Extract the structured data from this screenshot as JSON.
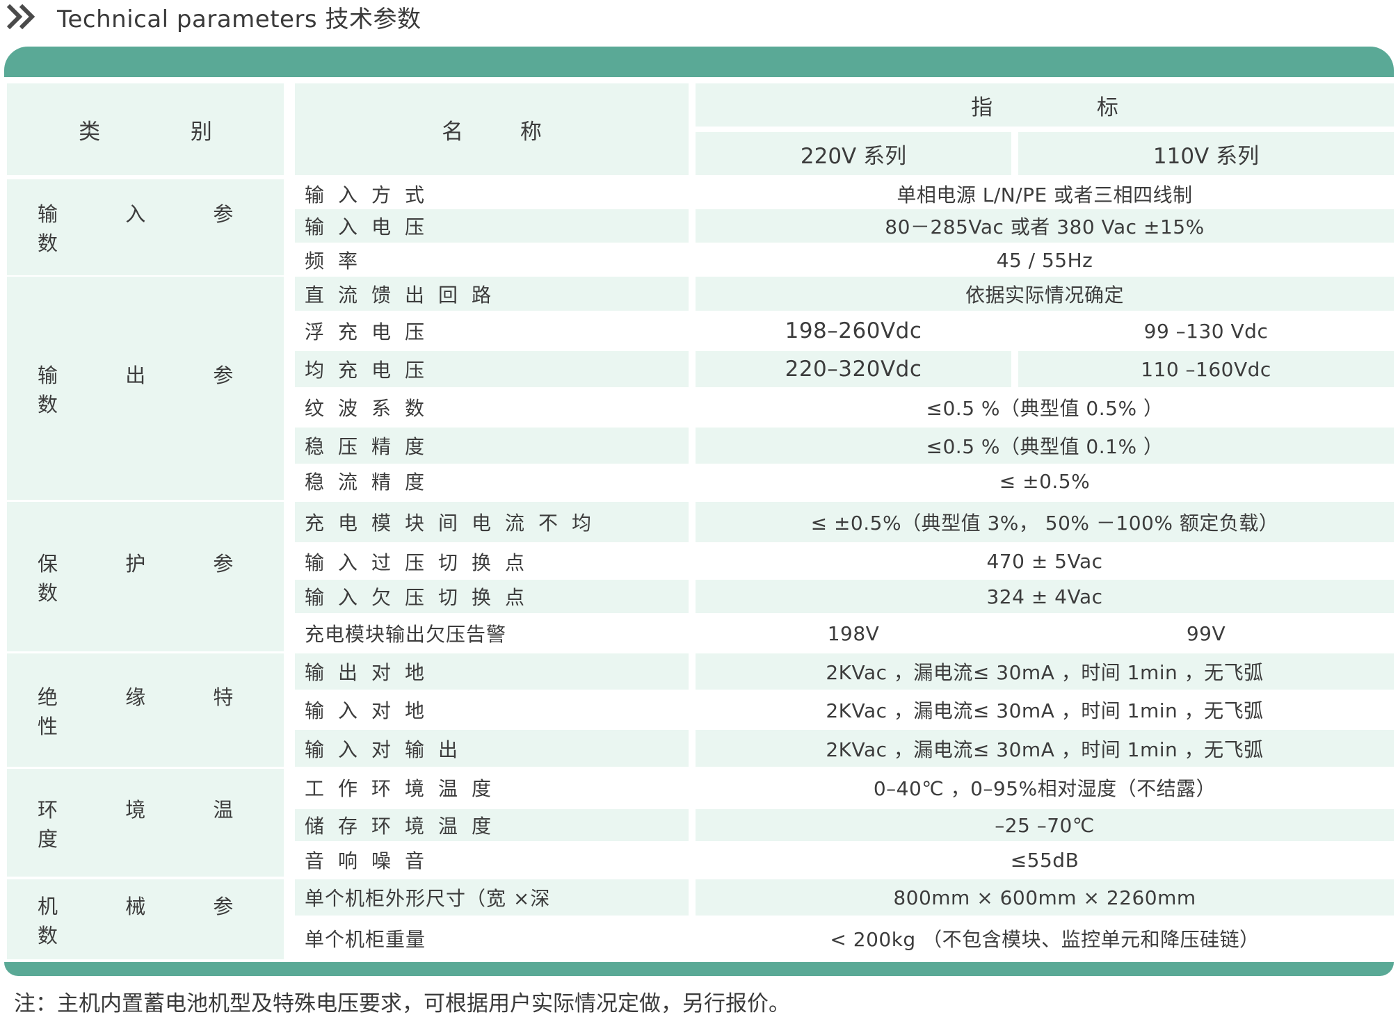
{
  "title": "Technical parameters 技术参数",
  "header": {
    "category": "类 别",
    "name": "名 称",
    "indicator": "指 标",
    "series_220": "220V 系列",
    "series_110": "110V 系列"
  },
  "categories": [
    "输 入 参 数",
    "输 出 参 数",
    "保 护 参 数",
    "绝 缘 特 性",
    "环 境 温 度",
    "机 械 参 数"
  ],
  "rows": [
    {
      "name": "输入方式",
      "value": "单相电源  L/N/PE  或者三相四线制"
    },
    {
      "name": "输入电压",
      "value": "80－285Vac    或者   380 Vac ±15%"
    },
    {
      "name": "频率",
      "value": "45 / 55Hz"
    },
    {
      "name": "直流馈出回路",
      "value": "依据实际情况确定"
    },
    {
      "name": "浮充电压",
      "v220": "198–260Vdc",
      "v110": "99 –130 Vdc"
    },
    {
      "name": "均充电压",
      "v220": "220–320Vdc",
      "v110": "110 –160Vdc"
    },
    {
      "name": "纹波系数",
      "value": "≤0.5  %（典型值  0.5%  ）"
    },
    {
      "name": "稳压精度",
      "value": "≤0.5  %（典型值  0.1%  ）"
    },
    {
      "name": "稳流精度",
      "value": "≤ ±0.5%"
    },
    {
      "name": "充电模块间电流不均",
      "value": "≤ ±0.5%（典型值  3%，  50% －100%  额定负载）"
    },
    {
      "name": "输入过压切换点",
      "value": "470 ± 5Vac"
    },
    {
      "name": "输入欠压切换点",
      "value": "324 ± 4Vac"
    },
    {
      "name": "充电模块输出欠压告警",
      "v220": "198V",
      "v110": "99V"
    },
    {
      "name": "输出对地",
      "value": "2KVac  ，漏电流≤  30mA      ，时间  1min ，无飞弧"
    },
    {
      "name": "输入对地",
      "value": "2KVac  ，漏电流≤  30mA      ，时间  1min ，无飞弧"
    },
    {
      "name": "输入对输出",
      "value": "2KVac  ，漏电流≤  30mA      ，时间  1min ，无飞弧"
    },
    {
      "name": "工作环境温度",
      "value": "0–40℃ ，0–95%相对湿度（不结露）"
    },
    {
      "name": "储存环境温度",
      "value": "–25 –70℃"
    },
    {
      "name": "音响噪音",
      "value": "≤55dB"
    },
    {
      "name": "单个机柜外形尺寸（宽 ×深",
      "value": "800mm   × 600mm   × 2260mm"
    },
    {
      "name": "单个机柜重量",
      "value": "< 200kg     （不包含模块、监控单元和降压硅链）"
    }
  ],
  "note": "注：主机内置蓄电池机型及特殊电压要求，可根据用户实际情况定做，另行报价。",
  "colors": {
    "accent": "#5aa996",
    "shade": "#eaf6f1",
    "text": "#3c3c3c"
  }
}
